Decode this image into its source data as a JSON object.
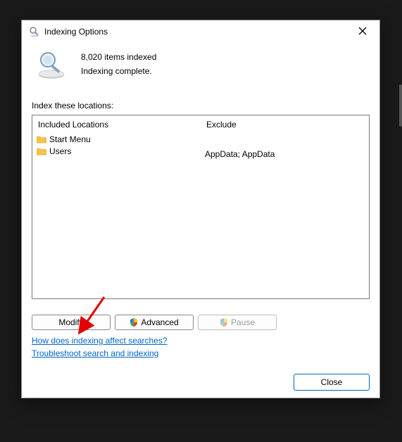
{
  "title": "Indexing Options",
  "status": {
    "count_line": "8,020 items indexed",
    "state_line": "Indexing complete."
  },
  "section_label": "Index these locations:",
  "columns": {
    "included_header": "Included Locations",
    "exclude_header": "Exclude"
  },
  "included": [
    {
      "label": "Start Menu",
      "exclude": ""
    },
    {
      "label": "Users",
      "exclude": "AppData; AppData"
    }
  ],
  "buttons": {
    "modify": "Modify",
    "advanced": "Advanced",
    "pause": "Pause"
  },
  "links": {
    "how": "How does indexing affect searches?",
    "troubleshoot": "Troubleshoot search and indexing"
  },
  "close": "Close"
}
